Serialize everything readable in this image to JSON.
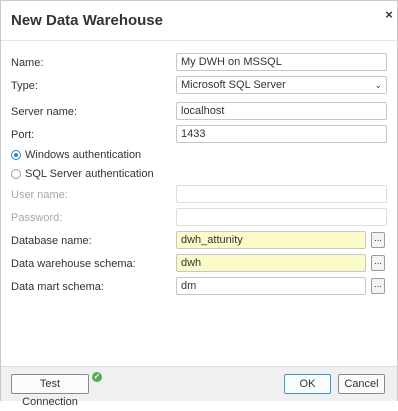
{
  "dialog": {
    "title": "New Data Warehouse",
    "close_glyph": "×"
  },
  "form": {
    "name_label": "Name:",
    "name_value": "My DWH on MSSQL",
    "type_label": "Type:",
    "type_value": "Microsoft SQL Server",
    "server_label": "Server name:",
    "server_value": "localhost",
    "port_label": "Port:",
    "port_value": "1433",
    "auth_windows_label": "Windows authentication",
    "auth_sql_label": "SQL Server authentication",
    "auth_selected": "windows",
    "username_label": "User name:",
    "username_value": "",
    "password_label": "Password:",
    "password_value": "",
    "database_label": "Database name:",
    "database_value": "dwh_attunity",
    "dwh_schema_label": "Data warehouse schema:",
    "dwh_schema_value": "dwh",
    "mart_schema_label": "Data mart schema:",
    "mart_schema_value": "dm",
    "browse_label": "..."
  },
  "footer": {
    "test_label": "Test Connection",
    "test_status": "success",
    "test_status_glyph": "✓",
    "ok_label": "OK",
    "cancel_label": "Cancel"
  },
  "colors": {
    "highlight_field": "#fbfbc9",
    "accent": "#1e88e5",
    "success": "#4caf50"
  },
  "icons": {
    "close": "close-icon",
    "dropdown": "chevron-down-icon",
    "test_status": "check-circle-icon"
  }
}
